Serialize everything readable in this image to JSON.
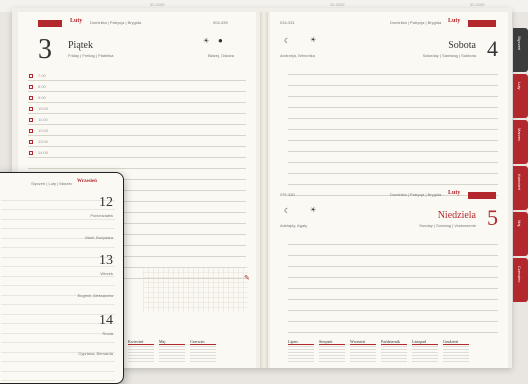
{
  "background": {
    "strip_labels": [
      "32.3209",
      "32.3209",
      "32.3209"
    ]
  },
  "left_page": {
    "tab_label": "Luty",
    "nav_text": "Dominika | Patrycja | Brygida",
    "date_code": "004-339",
    "day_number": "3",
    "day_name": "Piątek",
    "day_translations": "Friday | Freitag | Piatnitsa",
    "nameday": "Błażej, Oskara",
    "moon": "●",
    "hours": [
      "7:00",
      "8:00",
      "9:00",
      "10:00",
      "11:00",
      "12:00",
      "13:00",
      "14:00"
    ]
  },
  "right_page": {
    "top_date_code": "034-331",
    "top_nav": "Dominika | Patrycja | Brygida",
    "top_tab": "Luty",
    "top_day_name": "Sobota",
    "top_day_translations": "Saturday | Samstag | Subbota",
    "top_day_number": "4",
    "top_nameday": "Andrzeja, Weronika",
    "bottom_date_code": "035-330",
    "bottom_nav": "Dominika | Patrycja | Brygida",
    "bottom_tab": "Luty",
    "bottom_day_name": "Niedziela",
    "bottom_day_translations": "Sunday | Sonntag | Voskresenie",
    "bottom_day_number": "5",
    "bottom_nameday": "Adelajdy, Agaty"
  },
  "tabs": [
    "Styczeń",
    "Luty",
    "Marzec",
    "Kwiecień",
    "Maj",
    "Czerwiec"
  ],
  "calendar_left": [
    "Kwiecień",
    "Maj",
    "Czerwiec"
  ],
  "calendar_right": [
    "Lipiec",
    "Sierpień",
    "Wrzesień",
    "Październik",
    "Listopad",
    "Grudzień"
  ],
  "overlay": {
    "header_nav": "Styczeń | Luty | Marzec",
    "header_tab": "Wrzesień",
    "days": [
      {
        "num": "12",
        "name": "Poniedziałek",
        "nameday": "Marii, Bożydara"
      },
      {
        "num": "13",
        "name": "Wtorek",
        "nameday": "Eugenii, Aleksandra"
      },
      {
        "num": "14",
        "name": "Środa",
        "nameday": "Cypriana, Bernarda"
      }
    ]
  }
}
